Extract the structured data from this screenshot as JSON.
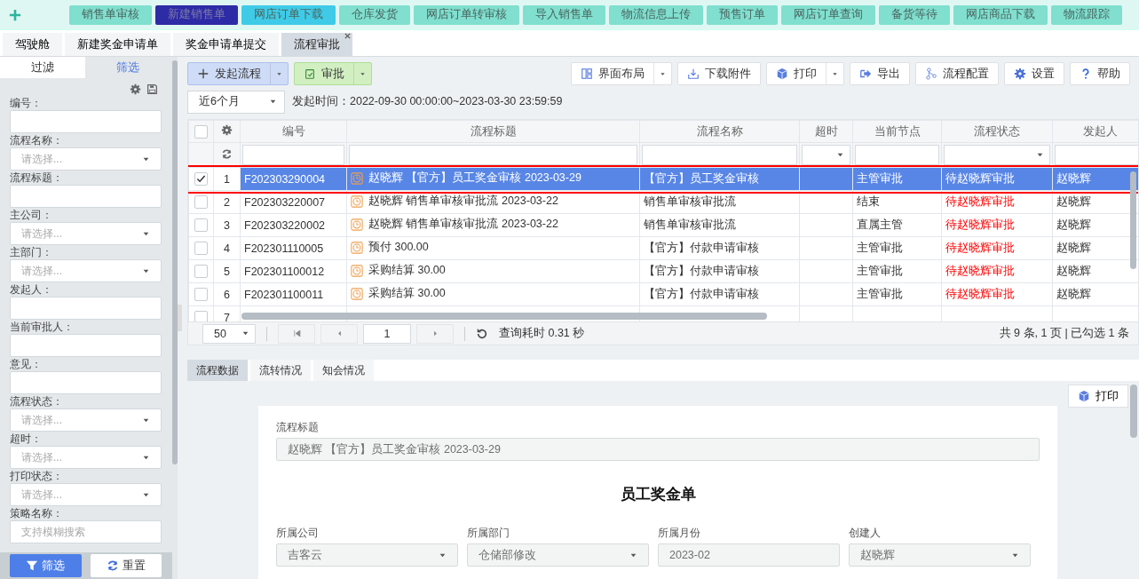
{
  "nav": {
    "items": [
      {
        "label": "销售单审核",
        "color": "#80dfcf"
      },
      {
        "label": "新建销售单",
        "color": "#2e2ba6"
      },
      {
        "label": "网店订单下载",
        "color": "#3fcbe8"
      },
      {
        "label": "仓库发货",
        "color": "#80dfcf"
      },
      {
        "label": "网店订单转审核",
        "color": "#80dfcf"
      },
      {
        "label": "导入销售单",
        "color": "#80dfcf"
      },
      {
        "label": "物流信息上传",
        "color": "#80dfcf"
      },
      {
        "label": "预售订单",
        "color": "#80dfcf"
      },
      {
        "label": "网店订单查询",
        "color": "#80dfcf"
      },
      {
        "label": "备货等待",
        "color": "#80dfcf"
      },
      {
        "label": "网店商品下载",
        "color": "#80dfcf"
      },
      {
        "label": "物流跟踪",
        "color": "#80dfcf"
      }
    ]
  },
  "tabs": [
    {
      "label": "驾驶舱",
      "selected": false
    },
    {
      "label": "新建奖金申请单",
      "selected": false
    },
    {
      "label": "奖金申请单提交",
      "selected": false
    },
    {
      "label": "流程审批",
      "selected": true,
      "closable": true
    }
  ],
  "filter_panel": {
    "tabs": [
      {
        "label": "过滤",
        "selected": false
      },
      {
        "label": "筛选",
        "selected": true
      }
    ],
    "fields": [
      {
        "label": "编号：",
        "kind": "text"
      },
      {
        "label": "流程名称：",
        "kind": "select",
        "placeholder": "请选择..."
      },
      {
        "label": "流程标题：",
        "kind": "text"
      },
      {
        "label": "主公司：",
        "kind": "select",
        "placeholder": "请选择..."
      },
      {
        "label": "主部门：",
        "kind": "select",
        "placeholder": "请选择..."
      },
      {
        "label": "发起人：",
        "kind": "text"
      },
      {
        "label": "当前审批人：",
        "kind": "text"
      },
      {
        "label": "意见：",
        "kind": "text"
      },
      {
        "label": "流程状态：",
        "kind": "select",
        "placeholder": "请选择..."
      },
      {
        "label": "超时：",
        "kind": "select",
        "placeholder": "请选择..."
      },
      {
        "label": "打印状态：",
        "kind": "select",
        "placeholder": "请选择..."
      },
      {
        "label": "策略名称：",
        "kind": "text",
        "placeholder": "支持模糊搜索"
      }
    ],
    "buttons": [
      {
        "label": "筛选",
        "kind": "filter"
      },
      {
        "label": "重置",
        "kind": "reset"
      }
    ]
  },
  "toolbar": {
    "left": [
      {
        "label": "发起流程",
        "kind": "start"
      },
      {
        "label": "审批",
        "kind": "approve"
      }
    ],
    "right": [
      {
        "label": "界面布局",
        "kind": "layout",
        "dropdown": true
      },
      {
        "label": "下载附件",
        "kind": "download",
        "dropdown": false
      },
      {
        "label": "打印",
        "kind": "print",
        "dropdown": true
      },
      {
        "label": "导出",
        "kind": "export",
        "dropdown": false
      },
      {
        "label": "流程配置",
        "kind": "flow",
        "dropdown": false
      },
      {
        "label": "设置",
        "kind": "settings",
        "dropdown": false
      },
      {
        "label": "帮助",
        "kind": "help",
        "dropdown": false
      }
    ]
  },
  "period": {
    "value": "近6个月"
  },
  "date_range": "发起时间：2022-09-30 00:00:00~2023-03-30 23:59:59",
  "table": {
    "columns": [
      {
        "label": "编号",
        "kind": "text"
      },
      {
        "label": "流程标题",
        "kind": "text"
      },
      {
        "label": "流程名称",
        "kind": "text"
      },
      {
        "label": "超时",
        "kind": "select"
      },
      {
        "label": "当前节点",
        "kind": "text"
      },
      {
        "label": "流程状态",
        "kind": "select"
      },
      {
        "label": "发起人",
        "kind": "text"
      }
    ],
    "all_checked": false,
    "rows": [
      {
        "checked": true,
        "selected": true,
        "index": "1",
        "cells": [
          "F202303290004",
          "赵晓辉 【官方】员工奖金审核 2023-03-29",
          "【官方】员工奖金审核",
          null,
          "主管审批",
          "待赵晓辉审批",
          "赵晓辉"
        ]
      },
      {
        "checked": false,
        "selected": false,
        "index": "2",
        "cells": [
          "F202303220007",
          "赵晓辉 销售单审核审批流 2023-03-22",
          "销售单审核审批流",
          null,
          "结束",
          "待赵晓辉审批",
          "赵晓辉"
        ]
      },
      {
        "checked": false,
        "selected": false,
        "index": "3",
        "cells": [
          "F202303220002",
          "赵晓辉 销售单审核审批流 2023-03-22",
          "销售单审核审批流",
          null,
          "直属主管",
          "待赵晓辉审批",
          "赵晓辉"
        ]
      },
      {
        "checked": false,
        "selected": false,
        "index": "4",
        "cells": [
          "F202301110005",
          "预付 300.00",
          "【官方】付款申请审核",
          null,
          "主管审批",
          "待赵晓辉审批",
          "赵晓辉"
        ]
      },
      {
        "checked": false,
        "selected": false,
        "index": "5",
        "cells": [
          "F202301100012",
          "采购结算 30.00",
          "【官方】付款申请审核",
          null,
          "主管审批",
          "待赵晓辉审批",
          "赵晓辉"
        ]
      },
      {
        "checked": false,
        "selected": false,
        "index": "6",
        "cells": [
          "F202301100011",
          "采购结算 30.00",
          "【官方】付款申请审核",
          null,
          "主管审批",
          "待赵晓辉审批",
          "赵晓辉"
        ]
      },
      {
        "checked": false,
        "selected": false,
        "index": "7",
        "cells": [
          null,
          null,
          null,
          null,
          null,
          null,
          null
        ]
      }
    ]
  },
  "pager": {
    "page_size": "50",
    "page": "1",
    "query_time": "查询耗时 0.31 秒",
    "summary": "共 9 条, 1 页 | 已勾选 1 条"
  },
  "detail": {
    "tabs": [
      {
        "label": "流程数据",
        "selected": true
      },
      {
        "label": "流转情况",
        "selected": false
      },
      {
        "label": "知会情况",
        "selected": false
      }
    ],
    "print": "打印",
    "form": {
      "title_label": "流程标题",
      "title_value": "赵晓辉 【官方】员工奖金审核 2023-03-29",
      "heading": "员工奖金单",
      "fields": [
        {
          "label": "所属公司",
          "value": "吉客云",
          "kind": "select"
        },
        {
          "label": "所属部门",
          "value": "仓储部修改",
          "kind": "select"
        },
        {
          "label": "所属月份",
          "value": "2023-02",
          "kind": "text"
        },
        {
          "label": "创建人",
          "value": "赵晓辉",
          "kind": "select"
        }
      ]
    }
  }
}
